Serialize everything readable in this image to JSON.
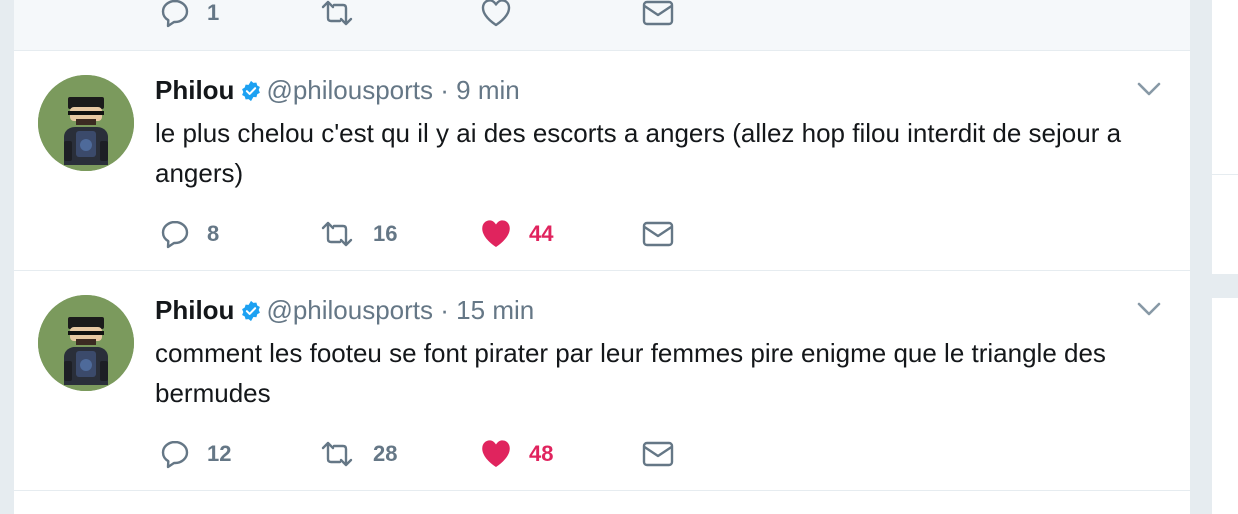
{
  "partial_tweet": {
    "reply_count": "1"
  },
  "tweets": [
    {
      "name": "Philou",
      "handle": "@philousports",
      "separator": "·",
      "time": "9 min",
      "text": "le plus chelou c'est qu il y ai des escorts a angers (allez hop filou interdit de sejour a angers)",
      "replies": "8",
      "retweets": "16",
      "likes": "44",
      "liked": true
    },
    {
      "name": "Philou",
      "handle": "@philousports",
      "separator": "·",
      "time": "15 min",
      "text": "comment les footeu se font pirater par leur femmes pire enigme que le triangle des bermudes",
      "replies": "12",
      "retweets": "28",
      "likes": "48",
      "liked": true
    }
  ],
  "colors": {
    "verified": "#1da1f2",
    "liked": "#e0245e",
    "muted": "#657786",
    "avatar_bg": "#7b9a5d"
  }
}
